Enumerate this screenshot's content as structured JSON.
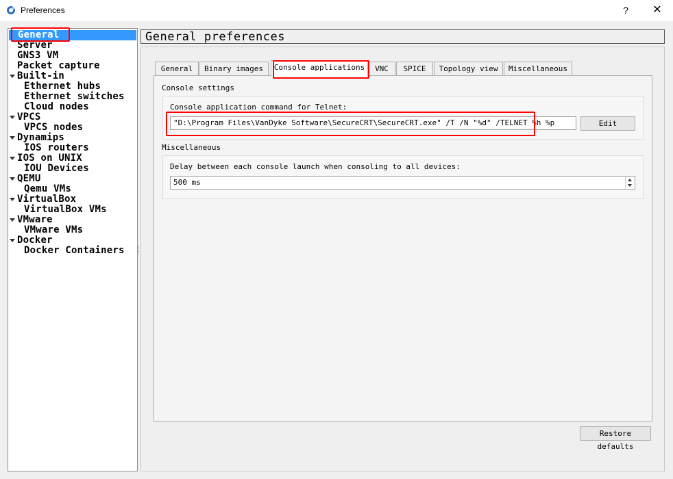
{
  "window": {
    "title": "Preferences",
    "help_label": "?",
    "close_label": "✕"
  },
  "sidebar": {
    "items": [
      {
        "label": "General",
        "selected": true
      },
      {
        "label": "Server"
      },
      {
        "label": "GNS3 VM"
      },
      {
        "label": "Packet capture"
      },
      {
        "label": "Built-in",
        "expanded": true
      },
      {
        "label": "Ethernet hubs"
      },
      {
        "label": "Ethernet switches"
      },
      {
        "label": "Cloud nodes"
      },
      {
        "label": "VPCS",
        "expanded": true
      },
      {
        "label": "VPCS nodes"
      },
      {
        "label": "Dynamips",
        "expanded": true
      },
      {
        "label": "IOS routers"
      },
      {
        "label": "IOS on UNIX",
        "expanded": true
      },
      {
        "label": "IOU Devices"
      },
      {
        "label": "QEMU",
        "expanded": true
      },
      {
        "label": "Qemu VMs"
      },
      {
        "label": "VirtualBox",
        "expanded": true
      },
      {
        "label": "VirtualBox VMs"
      },
      {
        "label": "VMware",
        "expanded": true
      },
      {
        "label": "VMware VMs"
      },
      {
        "label": "Docker",
        "expanded": true
      },
      {
        "label": "Docker Containers"
      }
    ]
  },
  "main": {
    "header": "General preferences",
    "tabs": [
      {
        "label": "General"
      },
      {
        "label": "Binary images"
      },
      {
        "label": "Console applications",
        "active": true
      },
      {
        "label": "VNC"
      },
      {
        "label": "SPICE"
      },
      {
        "label": "Topology view"
      },
      {
        "label": "Miscellaneous"
      }
    ],
    "console_settings": {
      "group_title": "Console settings",
      "telnet_label": "Console application command for Telnet:",
      "telnet_command": "\"D:\\Program Files\\VanDyke Software\\SecureCRT\\SecureCRT.exe\" /T /N \"%d\" /TELNET %h %p",
      "edit_label": "Edit"
    },
    "miscellaneous": {
      "group_title": "Miscellaneous",
      "delay_label": "Delay between each console launch when consoling to all devices:",
      "delay_value": "500 ms"
    },
    "restore_defaults_label": "Restore defaults"
  },
  "colors": {
    "selection": "#3399ff",
    "highlight": "#ff0000"
  }
}
